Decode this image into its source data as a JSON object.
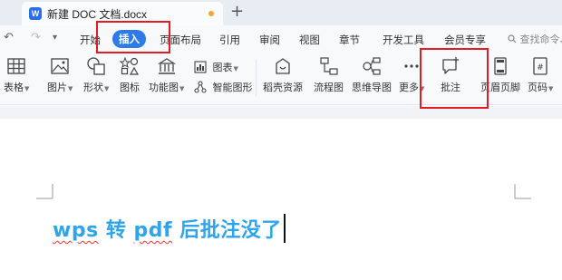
{
  "titlebar": {
    "app_icon": "wps-writer-icon",
    "app_icon_letter": "W",
    "doc_title": "新建 DOC 文档.docx",
    "new_tab_label": "+"
  },
  "quick_access": {
    "undo": "↶",
    "redo": "↷",
    "more": "▾"
  },
  "menu": {
    "items": [
      "开始",
      "插入",
      "页面布局",
      "引用",
      "审阅",
      "视图",
      "章节",
      "开发工具",
      "会员专享"
    ],
    "active": "插入",
    "search_label": "查找命令、"
  },
  "ribbon": {
    "table": "表格",
    "picture": "图片",
    "shape": "形状",
    "icon": "图标",
    "function_chart": "功能图",
    "chart": "图表",
    "smart_art": "智能图形",
    "docer_resources": "稻壳资源",
    "flowchart": "流程图",
    "mindmap": "思维导图",
    "more": "更多",
    "comment": "批注",
    "header_footer": "页眉页脚",
    "page_number": "页码"
  },
  "document": {
    "word_wps": "wps",
    "word_1": " 转 ",
    "word_pdf": "pdf",
    "word_2": " 后批注没了"
  },
  "colors": {
    "accent": "#2f7ae9",
    "highlight_box": "#e31b23",
    "doc_text": "#2fa4ea"
  }
}
